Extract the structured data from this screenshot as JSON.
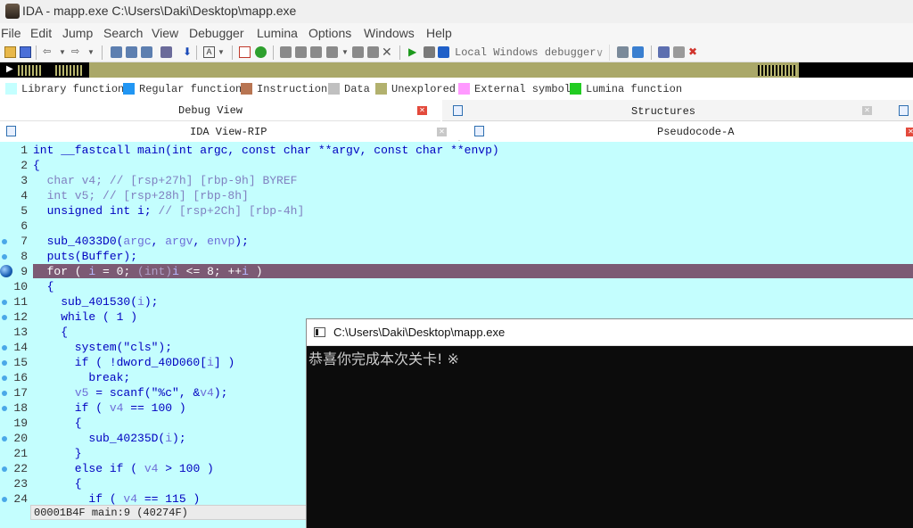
{
  "titlebar": {
    "title": "IDA - mapp.exe C:\\Users\\Daki\\Desktop\\mapp.exe"
  },
  "menu": [
    "File",
    "Edit",
    "Jump",
    "Search",
    "View",
    "Debugger",
    "Lumina",
    "Options",
    "Windows",
    "Help"
  ],
  "toolbar": {
    "debugger_select": "Local Windows debugger"
  },
  "legend": [
    {
      "label": "Library function",
      "color": "#c4ffff"
    },
    {
      "label": "Regular function",
      "color": "#2196f3"
    },
    {
      "label": "Instruction",
      "color": "#b87552"
    },
    {
      "label": "Data",
      "color": "#c0c0c0"
    },
    {
      "label": "Unexplored",
      "color": "#b2b16e"
    },
    {
      "label": "External symbol",
      "color": "#ff99ff"
    },
    {
      "label": "Lumina function",
      "color": "#22cc22"
    }
  ],
  "tabs": {
    "debug_view": "Debug View",
    "structures": "Structures",
    "ida_view": "IDA View-RIP",
    "pseudocode": "Pseudocode-A"
  },
  "status": {
    "address": "00001B4F",
    "location": "main:9",
    "offset": "(40274F)"
  },
  "console": {
    "title": "C:\\Users\\Daki\\Desktop\\mapp.exe",
    "output": "恭喜你完成本次关卡! ※"
  },
  "code": [
    {
      "n": "1",
      "t": "int __fastcall main(int argc, const char **argv, const char **envp)"
    },
    {
      "n": "2",
      "t": "{"
    },
    {
      "n": "3",
      "t": "  char v4; // [rsp+27h] [rbp-9h] BYREF"
    },
    {
      "n": "4",
      "t": "  int v5; // [rsp+28h] [rbp-8h]"
    },
    {
      "n": "5",
      "t": "  unsigned int i; // [rsp+2Ch] [rbp-4h]"
    },
    {
      "n": "6",
      "t": ""
    },
    {
      "n": "7",
      "t": "  sub_4033D0(argc, argv, envp);"
    },
    {
      "n": "8",
      "t": "  puts(Buffer);"
    },
    {
      "n": "9",
      "t": "  for ( i = 0; (int)i <= 8; ++i )"
    },
    {
      "n": "10",
      "t": "  {"
    },
    {
      "n": "11",
      "t": "    sub_401530(i);"
    },
    {
      "n": "12",
      "t": "    while ( 1 )"
    },
    {
      "n": "13",
      "t": "    {"
    },
    {
      "n": "14",
      "t": "      system(\"cls\");"
    },
    {
      "n": "15",
      "t": "      if ( !dword_40D060[i] )"
    },
    {
      "n": "16",
      "t": "        break;"
    },
    {
      "n": "17",
      "t": "      v5 = scanf(\"%c\", &v4);"
    },
    {
      "n": "18",
      "t": "      if ( v4 == 100 )"
    },
    {
      "n": "19",
      "t": "      {"
    },
    {
      "n": "20",
      "t": "        sub_40235D(i);"
    },
    {
      "n": "21",
      "t": "      }"
    },
    {
      "n": "22",
      "t": "      else if ( v4 > 100 )"
    },
    {
      "n": "23",
      "t": "      {"
    },
    {
      "n": "24",
      "t": "        if ( v4 == 115 )"
    }
  ]
}
